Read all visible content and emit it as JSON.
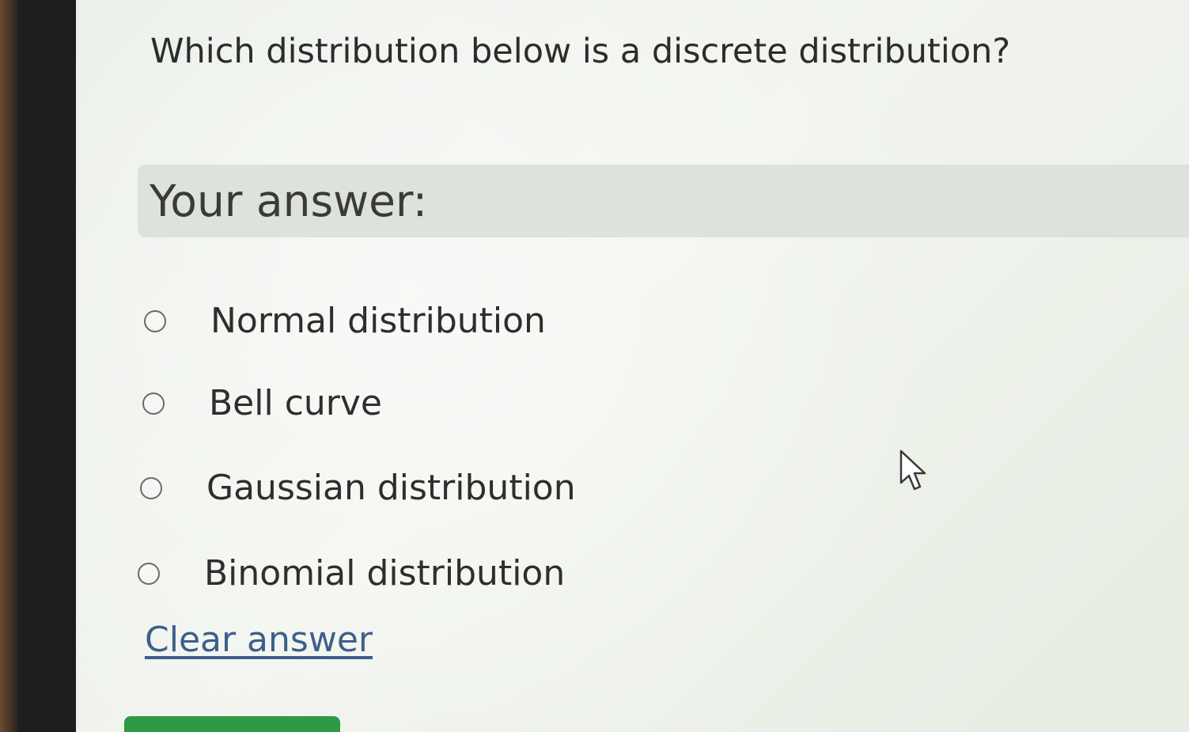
{
  "question": {
    "text": "Which distribution below is a discrete distribution?"
  },
  "answer_section": {
    "label": "Your answer:"
  },
  "options": [
    {
      "label": "Normal distribution",
      "selected": false
    },
    {
      "label": "Bell curve",
      "selected": false
    },
    {
      "label": "Gaussian distribution",
      "selected": false
    },
    {
      "label": "Binomial distribution",
      "selected": false
    }
  ],
  "clear_link": {
    "label": "Clear answer"
  },
  "colors": {
    "screen_background": "#eef2ea",
    "banner_background": "#dde2da",
    "link": "#3f5f8a",
    "submit_button": "#2e9a43"
  },
  "icons": {
    "cursor": "mouse-pointer-icon",
    "radio": "radio-unchecked-icon"
  }
}
